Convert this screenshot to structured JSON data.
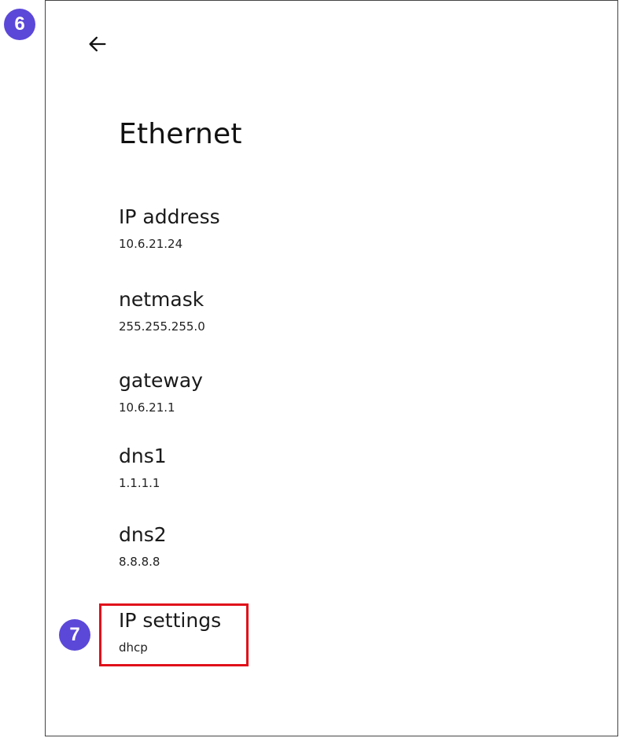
{
  "markers": {
    "first": "6",
    "second": "7"
  },
  "header": {
    "back_icon": "arrow-left-icon",
    "title": "Ethernet"
  },
  "settings": [
    {
      "title": "IP address",
      "value": "10.6.21.24"
    },
    {
      "title": "netmask",
      "value": "255.255.255.0"
    },
    {
      "title": "gateway",
      "value": "10.6.21.1"
    },
    {
      "title": "dns1",
      "value": "1.1.1.1"
    },
    {
      "title": "dns2",
      "value": "8.8.8.8"
    },
    {
      "title": "IP settings",
      "value": "dhcp"
    }
  ],
  "colors": {
    "marker": "#5b48d8",
    "highlight": "#e0101a"
  }
}
